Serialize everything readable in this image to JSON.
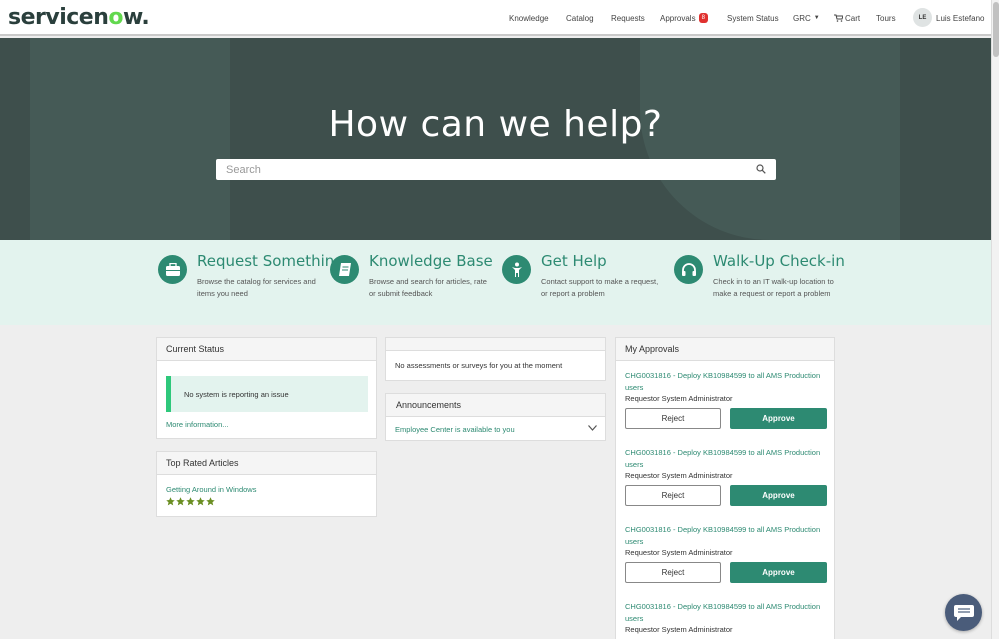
{
  "header": {
    "logo_text_a": "servicen",
    "logo_text_o": "o",
    "logo_text_b": "w.",
    "nav": {
      "knowledge": "Knowledge",
      "catalog": "Catalog",
      "requests": "Requests",
      "approvals": "Approvals",
      "approvals_count": "8",
      "system_status": "System Status",
      "grc": "GRC",
      "cart": "Cart",
      "tours": "Tours"
    },
    "user": {
      "initials": "LE",
      "name": "Luis Estefano"
    }
  },
  "hero": {
    "title": "How can we help?",
    "search_placeholder": "Search"
  },
  "services": [
    {
      "title": "Request Something",
      "desc": "Browse the catalog for services and items you need",
      "icon": "briefcase-icon"
    },
    {
      "title": "Knowledge Base",
      "desc": "Browse and search for articles, rate or submit feedback",
      "icon": "book-icon"
    },
    {
      "title": "Get Help",
      "desc": "Contact support to make a request, or report a problem",
      "icon": "person-icon"
    },
    {
      "title": "Walk-Up Check-in",
      "desc": "Check in to an IT walk-up location to make a request or report a problem",
      "icon": "headset-icon"
    }
  ],
  "current_status": {
    "title": "Current Status",
    "message": "No system is reporting an issue",
    "more_link": "More information..."
  },
  "top_rated": {
    "title": "Top Rated Articles",
    "article": "Getting Around in Windows",
    "rating": 5,
    "rating_max": 5
  },
  "assessments": {
    "message": "No assessments or surveys for you at the moment"
  },
  "announcements": {
    "title": "Announcements",
    "item": "Employee Center is available to you"
  },
  "my_approvals": {
    "title": "My Approvals",
    "reject_label": "Reject",
    "approve_label": "Approve",
    "items": [
      {
        "title": "CHG0031816 - Deploy KB10984599 to all AMS Production users",
        "requestor": "Requestor System Administrator"
      },
      {
        "title": "CHG0031816 - Deploy KB10984599 to all AMS Production users",
        "requestor": "Requestor System Administrator"
      },
      {
        "title": "CHG0031816 - Deploy KB10984599 to all AMS Production users",
        "requestor": "Requestor System Administrator"
      },
      {
        "title": "CHG0031816 - Deploy KB10984599 to all AMS Production users",
        "requestor": "Requestor System Administrator"
      }
    ]
  },
  "colors": {
    "brand_green": "#2d8a72",
    "hero_bg": "#3e4f4c",
    "band_bg": "#e3f3ee",
    "badge_red": "#e0312f",
    "status_accent": "#2ec87b"
  }
}
